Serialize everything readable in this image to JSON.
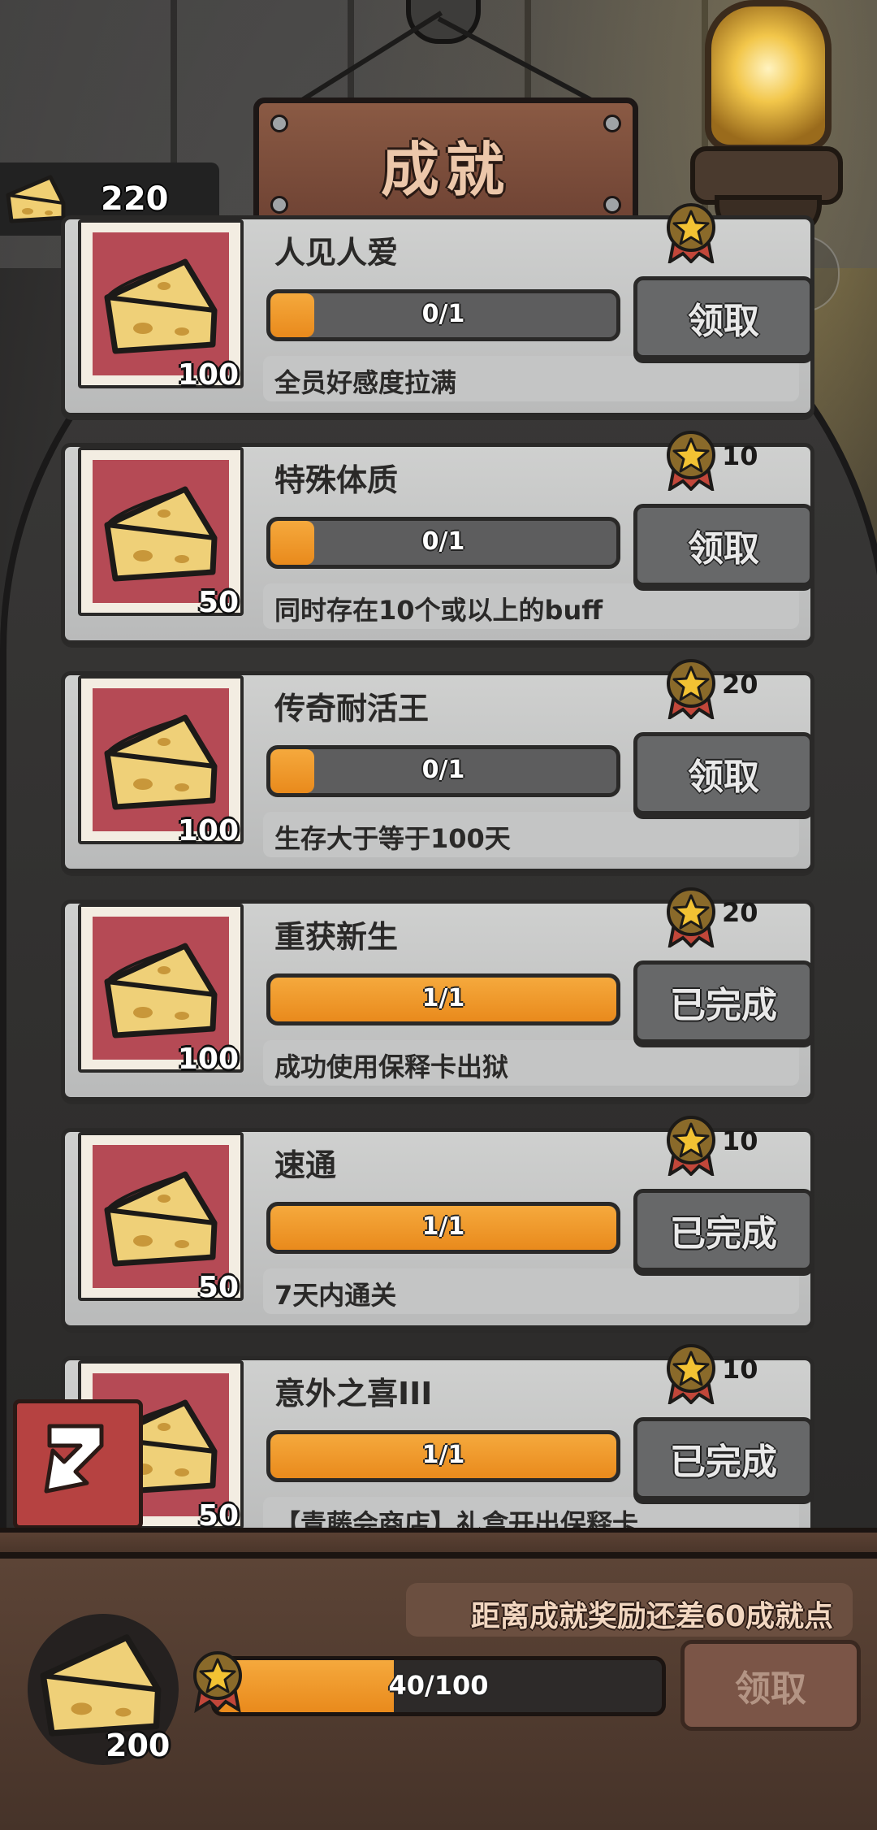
{
  "header": {
    "title": "成就"
  },
  "currency": {
    "amount": "220",
    "icon": "cheese-icon"
  },
  "achievements": [
    {
      "title": "人见人爱",
      "progress_text": "0/1",
      "progress": 0.0,
      "description": "全员好感度拉满",
      "cheese": "100",
      "reward": "",
      "button": "领取"
    },
    {
      "title": "特殊体质",
      "progress_text": "0/1",
      "progress": 0.0,
      "description": "同时存在10个或以上的buff",
      "cheese": "50",
      "reward": "10",
      "button": "领取"
    },
    {
      "title": "传奇耐活王",
      "progress_text": "0/1",
      "progress": 0.0,
      "description": "生存大于等于100天",
      "cheese": "100",
      "reward": "20",
      "button": "领取"
    },
    {
      "title": "重获新生",
      "progress_text": "1/1",
      "progress": 1.0,
      "description": "成功使用保释卡出狱",
      "cheese": "100",
      "reward": "20",
      "button": "已完成"
    },
    {
      "title": "速通",
      "progress_text": "1/1",
      "progress": 1.0,
      "description": "7天内通关",
      "cheese": "50",
      "reward": "10",
      "button": "已完成"
    },
    {
      "title": "意外之喜III",
      "progress_text": "1/1",
      "progress": 1.0,
      "description": "【青藤会商店】礼盒开出保释卡",
      "cheese": "50",
      "reward": "10",
      "button": "已完成"
    }
  ],
  "footer": {
    "hint": "距离成就奖励还差60成就点",
    "cheese": "200",
    "progress_text": "40/100",
    "progress": 0.4,
    "button": "领取"
  },
  "colors": {
    "accent": "#e98a1c",
    "card_bg": "#c6c7c7",
    "thumb_bg": "#b54a55",
    "back_button": "#b64241"
  }
}
